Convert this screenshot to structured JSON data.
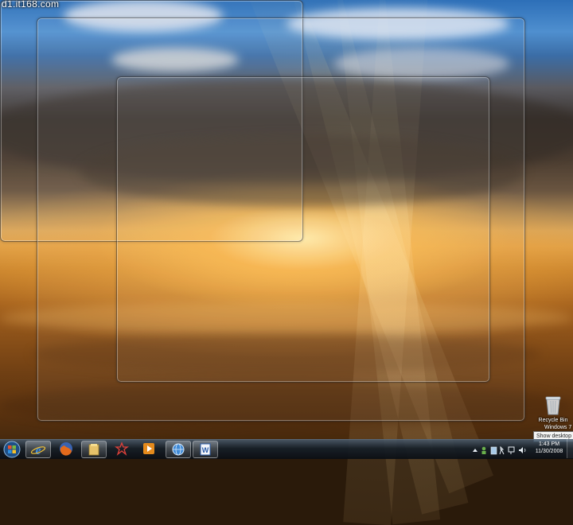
{
  "watermark": "d1.it168.com",
  "desktop": {
    "recycle_bin_label": "Recycle Bin",
    "os_label": "Windows 7",
    "tooltip": "Show desktop"
  },
  "taskbar": {
    "pinned": [
      {
        "name": "Internet Explorer",
        "icon": "ie-icon"
      },
      {
        "name": "Firefox",
        "icon": "firefox-icon"
      },
      {
        "name": "Windows Explorer",
        "icon": "folder-icon"
      },
      {
        "name": "App",
        "icon": "star-app-icon"
      },
      {
        "name": "Media Player",
        "icon": "media-player-icon"
      },
      {
        "name": "Globe App",
        "icon": "globe-icon"
      },
      {
        "name": "Microsoft Word",
        "icon": "word-icon"
      }
    ],
    "clock": {
      "time": "1:43 PM",
      "date": "11/30/2008"
    }
  },
  "colors": {
    "taskbar": "#141c26",
    "sky_blue": "#2d6fb8",
    "sunset_orange": "#e0a048"
  }
}
